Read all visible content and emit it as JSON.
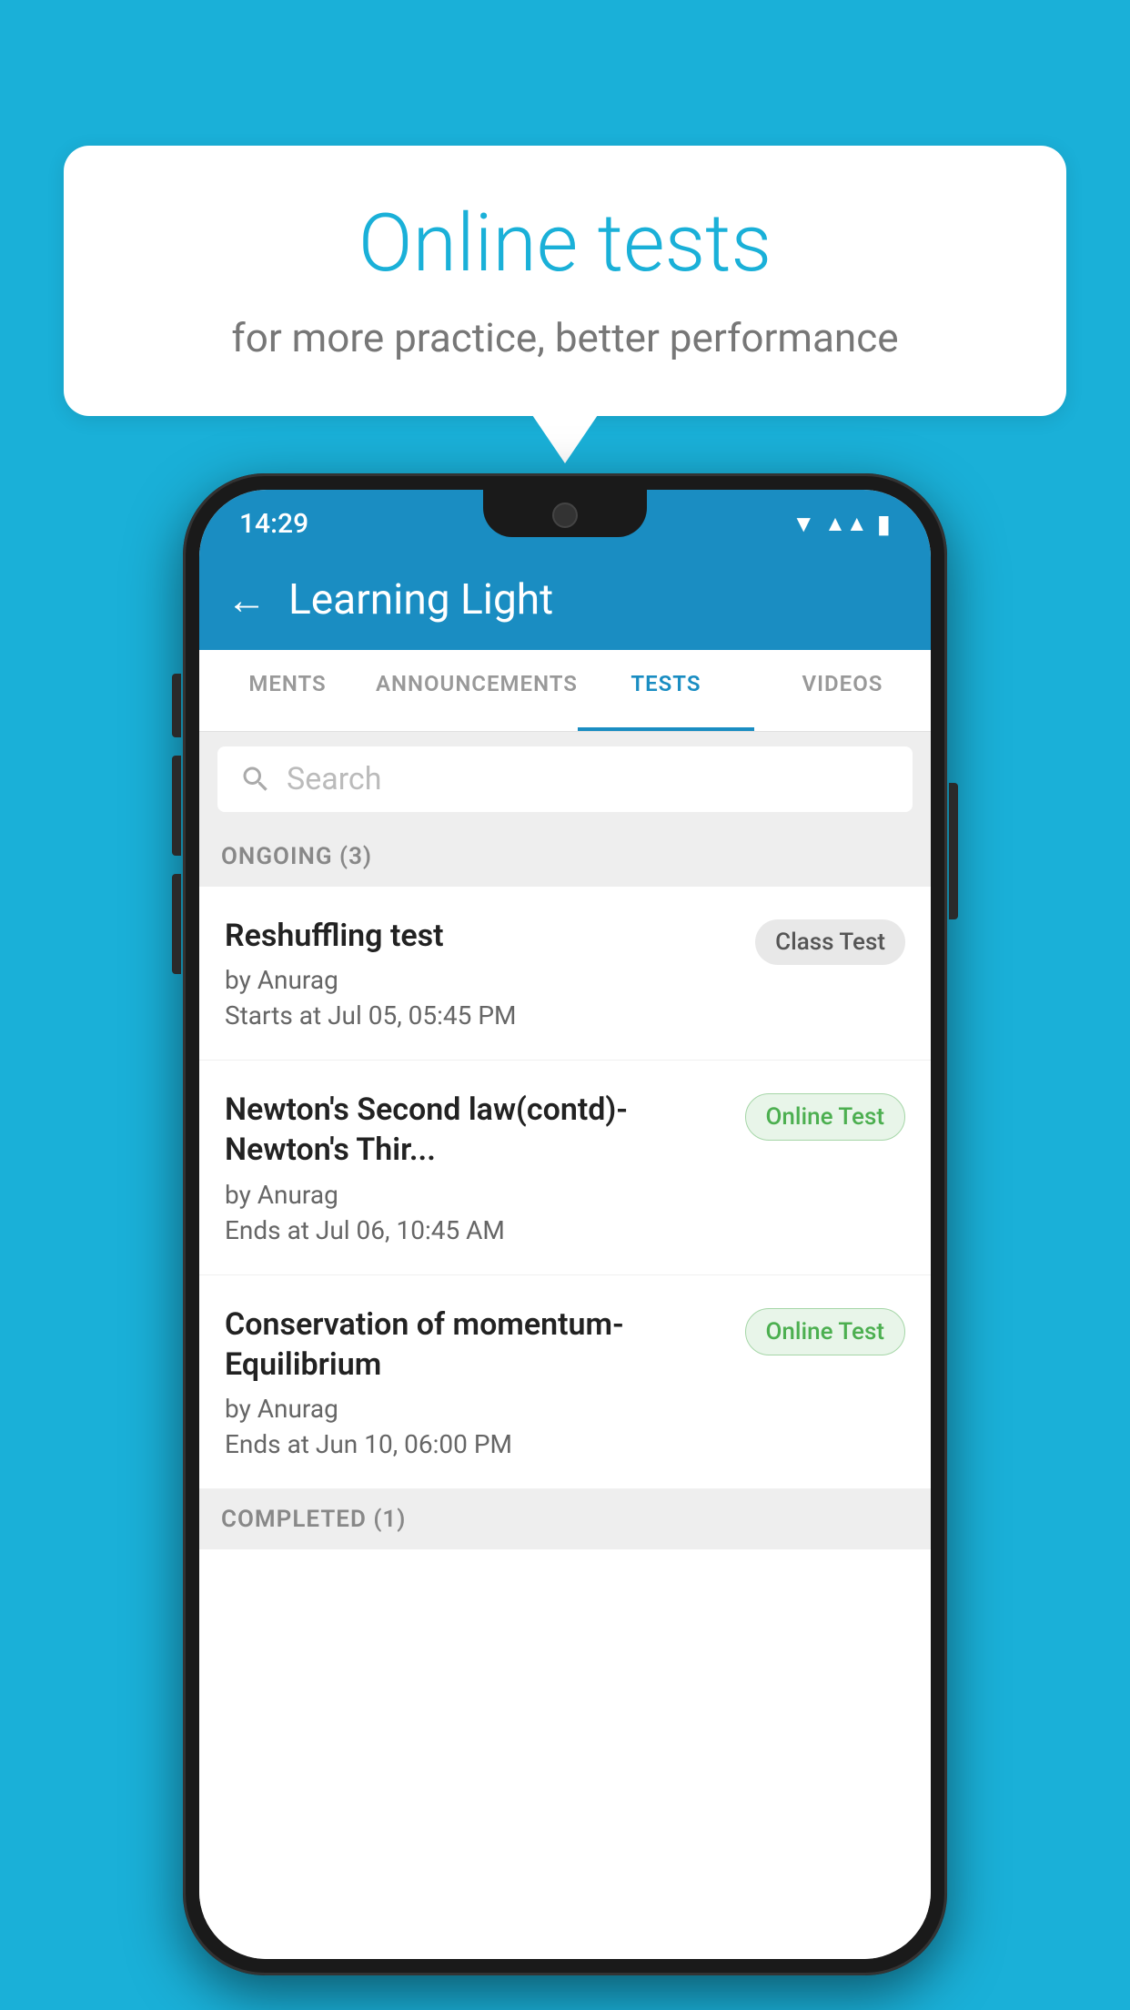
{
  "background_color": "#1ab0d8",
  "bubble": {
    "title": "Online tests",
    "subtitle": "for more practice, better performance"
  },
  "phone": {
    "status_bar": {
      "time": "14:29",
      "wifi": "▼",
      "signal": "▲",
      "battery": "▐"
    },
    "app_bar": {
      "title": "Learning Light",
      "back_label": "←"
    },
    "tabs": [
      {
        "label": "MENTS",
        "active": false
      },
      {
        "label": "ANNOUNCEMENTS",
        "active": false
      },
      {
        "label": "TESTS",
        "active": true
      },
      {
        "label": "VIDEOS",
        "active": false
      }
    ],
    "search": {
      "placeholder": "Search"
    },
    "ongoing_section": {
      "header": "ONGOING (3)"
    },
    "tests": [
      {
        "title": "Reshuffling test",
        "author": "by Anurag",
        "time_label": "Starts at",
        "time": "Jul 05, 05:45 PM",
        "badge": "Class Test",
        "badge_type": "class"
      },
      {
        "title": "Newton's Second law(contd)-Newton's Thir...",
        "author": "by Anurag",
        "time_label": "Ends at",
        "time": "Jul 06, 10:45 AM",
        "badge": "Online Test",
        "badge_type": "online"
      },
      {
        "title": "Conservation of momentum-Equilibrium",
        "author": "by Anurag",
        "time_label": "Ends at",
        "time": "Jun 10, 06:00 PM",
        "badge": "Online Test",
        "badge_type": "online"
      }
    ],
    "completed_section": {
      "header": "COMPLETED (1)"
    }
  }
}
